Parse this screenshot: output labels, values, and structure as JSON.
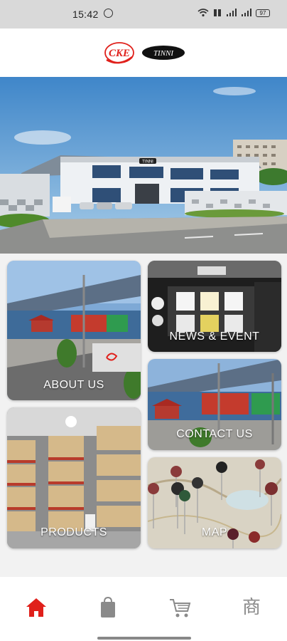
{
  "status_bar": {
    "time": "15:42",
    "battery": "97"
  },
  "brand": {
    "logo_left": "CKE",
    "logo_right": "TINNI"
  },
  "banner": {
    "building_sign": "TINNI"
  },
  "tiles": {
    "about": "ABOUT US",
    "news": "NEWS & EVENT",
    "contact": "CONTACT US",
    "products": "PRODUCTS",
    "map": "MAP"
  },
  "bottom_nav": {
    "items": [
      {
        "icon": "home-icon",
        "active": true,
        "color": "#e0201b"
      },
      {
        "icon": "shopping-bag-icon",
        "active": false,
        "color": "#8a8a8a"
      },
      {
        "icon": "cart-icon",
        "active": false,
        "color": "#8a8a8a"
      },
      {
        "icon": "shop-glyph",
        "glyph": "商",
        "active": false,
        "color": "#8a8a8a"
      }
    ]
  },
  "colors": {
    "accent": "#e0201b",
    "header_bg": "#ffffff",
    "page_bg": "#f2f2f2"
  }
}
